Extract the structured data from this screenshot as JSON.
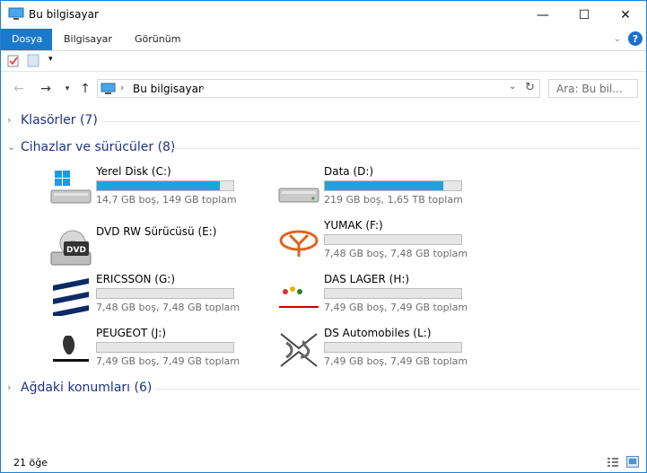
{
  "window": {
    "title": "Bu bilgisayar"
  },
  "controls": {
    "minimize": "—",
    "maximize": "☐",
    "close": "✕"
  },
  "ribbon": {
    "tabs": [
      {
        "label": "Dosya",
        "active": true
      },
      {
        "label": "Bilgisayar"
      },
      {
        "label": "Görünüm"
      }
    ],
    "help": "?"
  },
  "address": {
    "path": "Bu bilgisayar",
    "search_placeholder": "Ara: Bu bil..."
  },
  "groups": {
    "folders": "Klasörler (7)",
    "devices": "Cihazlar ve sürücüler (8)",
    "network": "Ağdaki konumları (6)"
  },
  "drives": [
    {
      "name": "Yerel Disk (C:)",
      "info": "14,7 GB boş, 149 GB toplam",
      "fill": 0.9,
      "icon": "windows-disk-icon"
    },
    {
      "name": "Data (D:)",
      "info": "219 GB boş, 1,65 TB toplam",
      "fill": 0.87,
      "icon": "hard-disk-icon"
    },
    {
      "name": "DVD RW Sürücüsü (E:)",
      "info": "",
      "fill": null,
      "icon": "dvd-drive-icon"
    },
    {
      "name": "YUMAK (F:)",
      "info": "7,48 GB boş, 7,48 GB toplam",
      "fill": 0,
      "icon": "yumak-logo-icon"
    },
    {
      "name": "ERICSSON (G:)",
      "info": "7,48 GB boş, 7,48 GB toplam",
      "fill": 0,
      "icon": "ericsson-logo-icon"
    },
    {
      "name": "DAS LAGER (H:)",
      "info": "7,49 GB boş, 7,49 GB toplam",
      "fill": 0,
      "icon": "das-lager-logo-icon"
    },
    {
      "name": "PEUGEOT (J:)",
      "info": "7,49 GB boş, 7,49 GB toplam",
      "fill": 0,
      "icon": "peugeot-logo-icon"
    },
    {
      "name": "DS Automobiles (L:)",
      "info": "7,49 GB boş, 7,49 GB toplam",
      "fill": 0,
      "icon": "ds-logo-icon"
    }
  ],
  "status": {
    "count": "21 öğe"
  },
  "colors": {
    "accent": "#1979ca",
    "bar": "#26a0da",
    "group": "#1e3287"
  }
}
